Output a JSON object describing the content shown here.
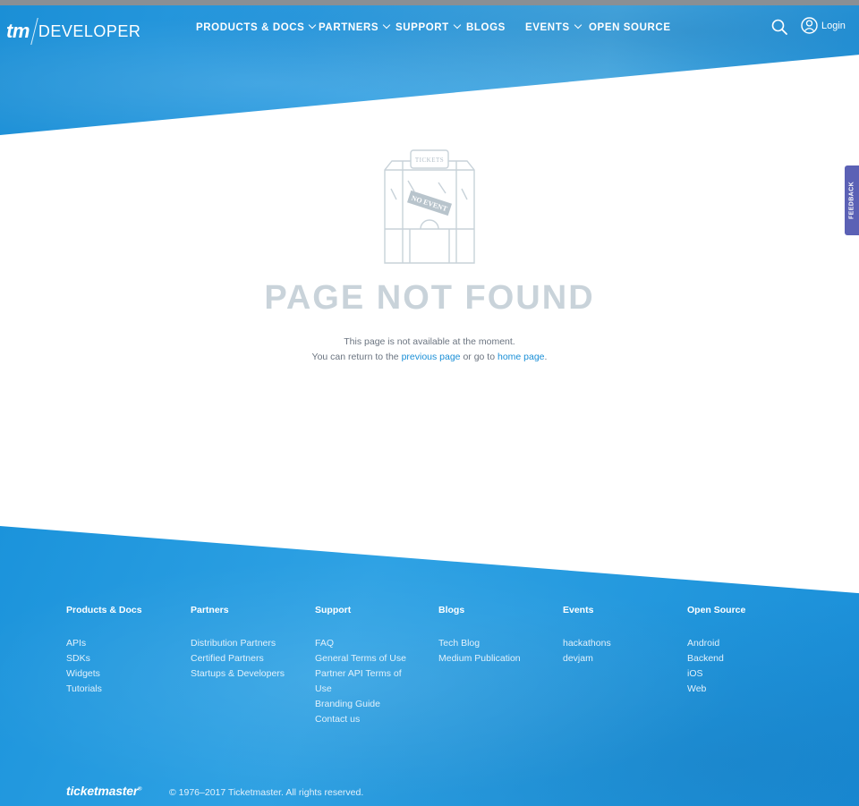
{
  "header": {
    "logo_tm": "tm",
    "logo_text": "DEVELOPER",
    "nav": [
      {
        "label": "PRODUCTS & DOCS",
        "has_dropdown": true
      },
      {
        "label": "PARTNERS",
        "has_dropdown": true
      },
      {
        "label": "SUPPORT",
        "has_dropdown": true
      },
      {
        "label": "BLOGS",
        "has_dropdown": false
      },
      {
        "label": "EVENTS",
        "has_dropdown": true
      },
      {
        "label": "OPEN SOURCE",
        "has_dropdown": false
      }
    ],
    "search_icon": "search-icon",
    "login_icon": "user-circle-icon",
    "login_label": "Login"
  },
  "feedback_tab": {
    "label": "FEEDBACK"
  },
  "main": {
    "illustration": {
      "sign_text": "TICKETS",
      "stamp_text": "NO EVENT"
    },
    "title": "PAGE NOT FOUND",
    "line1": "This page is not available at the moment.",
    "line2_prefix": "You can return to the ",
    "previous_link": "previous page",
    "line2_middle": " or go to ",
    "home_link": "home page",
    "line2_suffix": "."
  },
  "footer": {
    "columns": [
      {
        "heading": "Products & Docs",
        "links": [
          "APIs",
          "SDKs",
          "Widgets",
          "Tutorials"
        ]
      },
      {
        "heading": "Partners",
        "links": [
          "Distribution Partners",
          "Certified Partners",
          "Startups & Developers"
        ]
      },
      {
        "heading": "Support",
        "links": [
          "FAQ",
          "General Terms of Use",
          "Partner API Terms of",
          "Use",
          "Branding Guide",
          "Contact us"
        ]
      },
      {
        "heading": "Blogs",
        "links": [
          "Tech Blog",
          "Medium Publication"
        ]
      },
      {
        "heading": "Events",
        "links": [
          "hackathons",
          "devjam"
        ]
      },
      {
        "heading": "Open Source",
        "links": [
          "Android",
          "Backend",
          "iOS",
          "Web"
        ]
      }
    ],
    "brand": "ticketmaster",
    "brand_mark": "®",
    "copyright": "© 1976–2017 Ticketmaster. All rights reserved."
  },
  "colors": {
    "brand_blue": "#2196dc",
    "link": "#1a8fd7",
    "title": "#c9d3da",
    "feedback": "#5b61b5"
  }
}
